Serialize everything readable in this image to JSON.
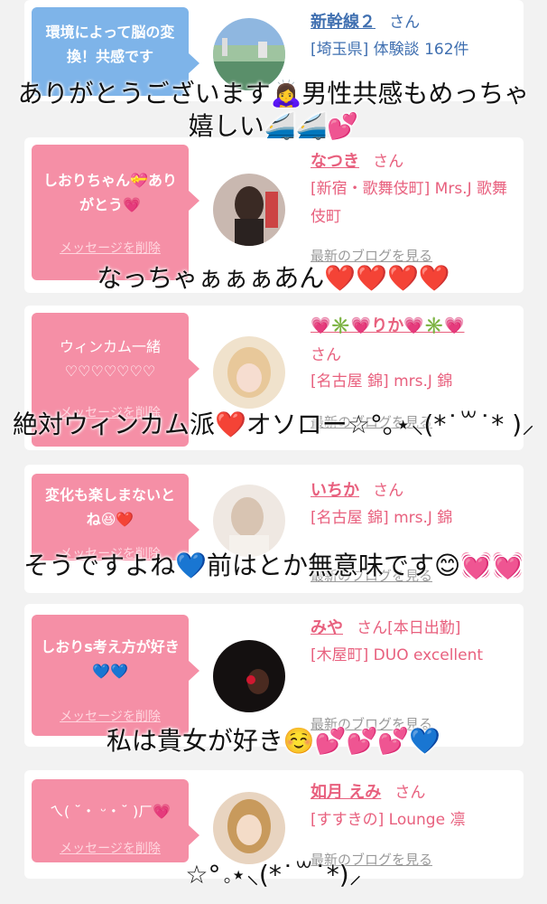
{
  "cards": [
    {
      "bubble_text": "環境によって脳の変換！共感です",
      "name": "新幹線２",
      "san": "さん",
      "meta": "[埼玉県] 体験談 162件"
    },
    {
      "bubble_text": "しおりちゃん💝ありがとう💗",
      "delete_label": "メッセージを削除",
      "name": "なつき",
      "san": "さん",
      "meta": "[新宿・歌舞伎町] Mrs.J 歌舞伎町",
      "blog_label": "最新のブログを見る"
    },
    {
      "bubble_text": "ウィンカム一緒♡♡♡♡♡♡♡",
      "delete_label": "メッセージを削除",
      "name": "💗✳️💗りか💗✳️💗",
      "san": "さん",
      "meta": "[名古屋 錦] mrs.J 錦",
      "blog_label": "最新のブログを見る"
    },
    {
      "bubble_text": "変化も楽しまないとね😆❤️",
      "delete_label": "メッセージを削除",
      "name": "いちか",
      "san": "さん",
      "meta": "[名古屋 錦] mrs.J 錦",
      "blog_label": "最新のブログを見る"
    },
    {
      "bubble_text": "しおりs考え方が好き💙💙",
      "delete_label": "メッセージを削除",
      "name": "みや",
      "san": "さん[本日出勤]",
      "meta": "[木屋町] DUO excellent",
      "blog_label": "最新のブログを見る"
    },
    {
      "bubble_text": "ㄟ( ˘・ ᵕ・˘ )ㄏ💗",
      "delete_label": "メッセージを削除",
      "name": "如月 えみ",
      "san": "さん",
      "meta": "[すすきの] Lounge 凛",
      "blog_label": "最新のブログを見る"
    }
  ],
  "overlays": {
    "line1": "ありがとうございます🙇‍♀️男性共感もめっちゃ嬉しい🚄🚄💕",
    "line2": "なっちゃぁぁぁあん❤️❤️❤️❤️",
    "line3": "絶対ウィンカム派❤️オソロー☆°｡⋆⸜(*˙꒳˙* )⸝",
    "line4": "そうですよね💙前はとか無意味です😊💓💓",
    "line5": "私は貴女が好き☺️💕💕💕💙",
    "line6": "☆°｡⋆⸜(*˙꒳˙*)⸝"
  },
  "colors": {
    "pink_bubble": "#f58fa6",
    "blue_bubble": "#7eb4e9",
    "pink_text": "#e8607e",
    "blue_text": "#3f6fb0"
  }
}
